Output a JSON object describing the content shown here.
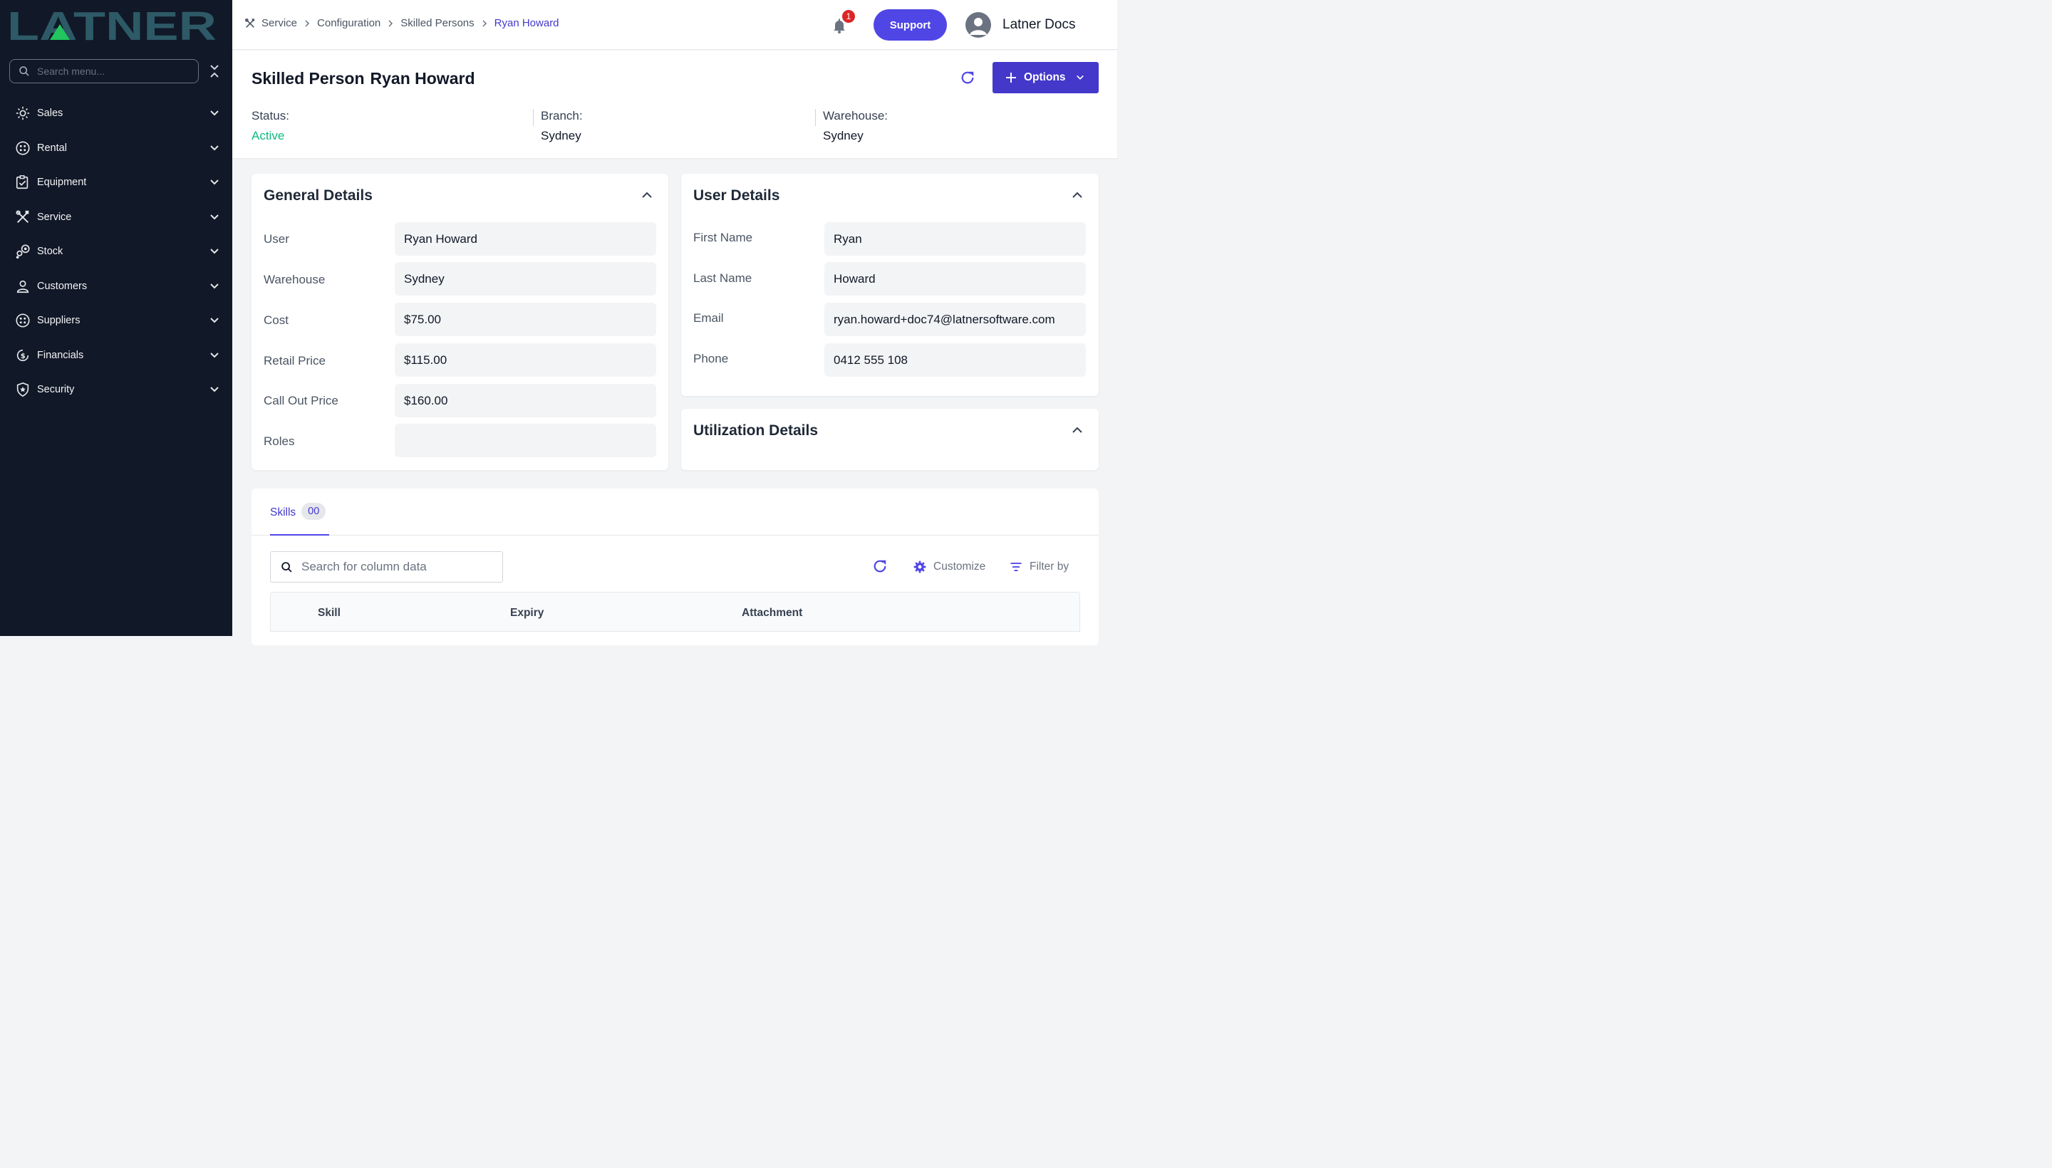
{
  "brand": {
    "logo_text": "LATNER",
    "logo_color": "#2d5a66",
    "logo_accent": "#22c55e"
  },
  "sidebar": {
    "search_placeholder": "Search menu...",
    "items": [
      {
        "label": "Sales",
        "icon": "sales-icon"
      },
      {
        "label": "Rental",
        "icon": "rental-icon"
      },
      {
        "label": "Equipment",
        "icon": "equipment-icon"
      },
      {
        "label": "Service",
        "icon": "service-icon"
      },
      {
        "label": "Stock",
        "icon": "stock-icon"
      },
      {
        "label": "Customers",
        "icon": "customers-icon"
      },
      {
        "label": "Suppliers",
        "icon": "suppliers-icon"
      },
      {
        "label": "Financials",
        "icon": "financials-icon"
      },
      {
        "label": "Security",
        "icon": "security-icon"
      }
    ]
  },
  "topbar": {
    "breadcrumb": [
      "Service",
      "Configuration",
      "Skilled Persons",
      "Ryan Howard"
    ],
    "notification_count": "1",
    "support_label": "Support",
    "user_name": "Latner Docs"
  },
  "header": {
    "title_prefix": "Skilled Person",
    "title_name": "Ryan Howard",
    "options_label": "Options",
    "status_label": "Status:",
    "status_value": "Active",
    "branch_label": "Branch:",
    "branch_value": "Sydney",
    "warehouse_label": "Warehouse:",
    "warehouse_value": "Sydney"
  },
  "general_details": {
    "title": "General Details",
    "fields": [
      {
        "label": "User",
        "value": "Ryan Howard"
      },
      {
        "label": "Warehouse",
        "value": "Sydney"
      },
      {
        "label": "Cost",
        "value": "$75.00"
      },
      {
        "label": "Retail Price",
        "value": "$115.00"
      },
      {
        "label": "Call Out Price",
        "value": "$160.00"
      },
      {
        "label": "Roles",
        "value": ""
      }
    ]
  },
  "user_details": {
    "title": "User Details",
    "fields": [
      {
        "label": "First Name",
        "value": "Ryan"
      },
      {
        "label": "Last Name",
        "value": "Howard"
      },
      {
        "label": "Email",
        "value": "ryan.howard+doc74@latnersoftware.com"
      },
      {
        "label": "Phone",
        "value": "0412 555 108"
      }
    ]
  },
  "utilization_details": {
    "title": "Utilization Details"
  },
  "skills": {
    "tab_label": "Skills",
    "tab_count": "00",
    "search_placeholder": "Search for column data",
    "customize_label": "Customize",
    "filter_label": "Filter by",
    "columns": [
      "Skill",
      "Expiry",
      "Attachment"
    ]
  },
  "colors": {
    "primary": "#4f46e5",
    "sidebar_bg": "#111827",
    "active_status": "#10b981",
    "badge": "#dc2626"
  }
}
